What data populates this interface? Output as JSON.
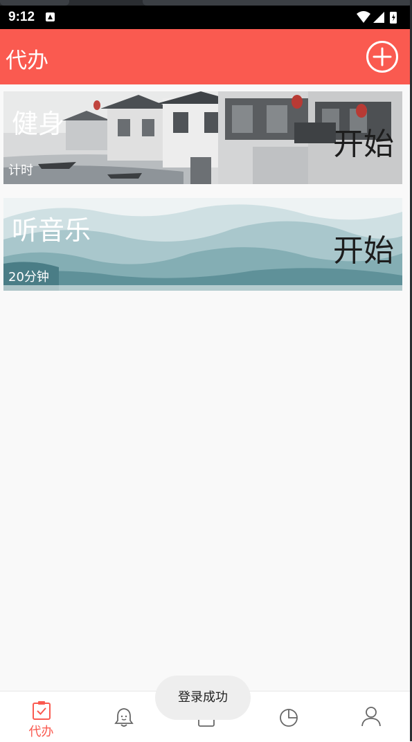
{
  "status_bar": {
    "time": "9:12"
  },
  "appbar": {
    "title": "代办",
    "add_icon": "plus-circle-icon"
  },
  "tasks": [
    {
      "title": "健身",
      "subtitle": "计时",
      "action": "开始",
      "background": "ink-painting-village"
    },
    {
      "title": "听音乐",
      "subtitle": "20分钟",
      "action": "开始",
      "background": "ink-painting-mountains"
    }
  ],
  "bottom_nav": {
    "items": [
      {
        "id": "todo",
        "label": "代办",
        "icon": "calendar-check-icon",
        "active": true
      },
      {
        "id": "reminder",
        "label": "",
        "icon": "bell-icon",
        "active": false
      },
      {
        "id": "notes",
        "label": "",
        "icon": "note-icon",
        "active": false
      },
      {
        "id": "stats",
        "label": "",
        "icon": "pie-chart-icon",
        "active": false
      },
      {
        "id": "profile",
        "label": "",
        "icon": "user-icon",
        "active": false
      }
    ]
  },
  "toast": {
    "message": "登录成功"
  },
  "colors": {
    "accent": "#fa5a50",
    "nav_inactive": "#666666",
    "background": "#f9f9f9"
  }
}
